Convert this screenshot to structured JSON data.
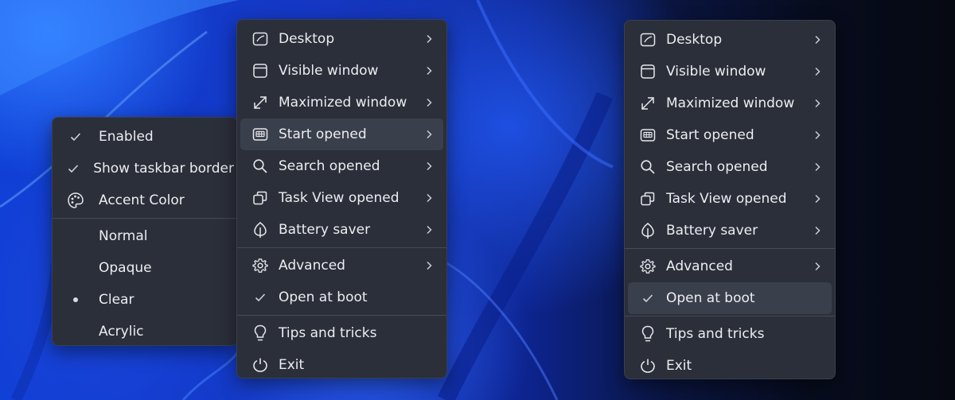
{
  "accent_menu": {
    "items": [
      {
        "label": "Enabled",
        "icon": "check-icon"
      },
      {
        "label": "Show taskbar border",
        "icon": "check-icon"
      },
      {
        "label": "Accent Color",
        "icon": "palette-icon"
      }
    ],
    "styles": [
      {
        "label": "Normal",
        "selected": false
      },
      {
        "label": "Opaque",
        "selected": false
      },
      {
        "label": "Clear",
        "selected": true
      },
      {
        "label": "Acrylic",
        "selected": false
      }
    ]
  },
  "main_menu": {
    "items": [
      {
        "label": "Desktop",
        "icon": "desktop-icon"
      },
      {
        "label": "Visible window",
        "icon": "window-icon"
      },
      {
        "label": "Maximized window",
        "icon": "maximize-icon"
      },
      {
        "label": "Start opened",
        "icon": "start-icon"
      },
      {
        "label": "Search opened",
        "icon": "search-icon"
      },
      {
        "label": "Task View opened",
        "icon": "task-view-icon"
      },
      {
        "label": "Battery saver",
        "icon": "leaf-icon"
      }
    ],
    "advanced_label": "Advanced",
    "open_at_boot_label": "Open at boot",
    "tips_label": "Tips and tricks",
    "exit_label": "Exit"
  },
  "colors": {
    "menu_background": "#2b2f3a",
    "hover_background": "#3a3f4c",
    "text": "#ecedf0",
    "wallpaper_blue": "#1e4fe0"
  }
}
